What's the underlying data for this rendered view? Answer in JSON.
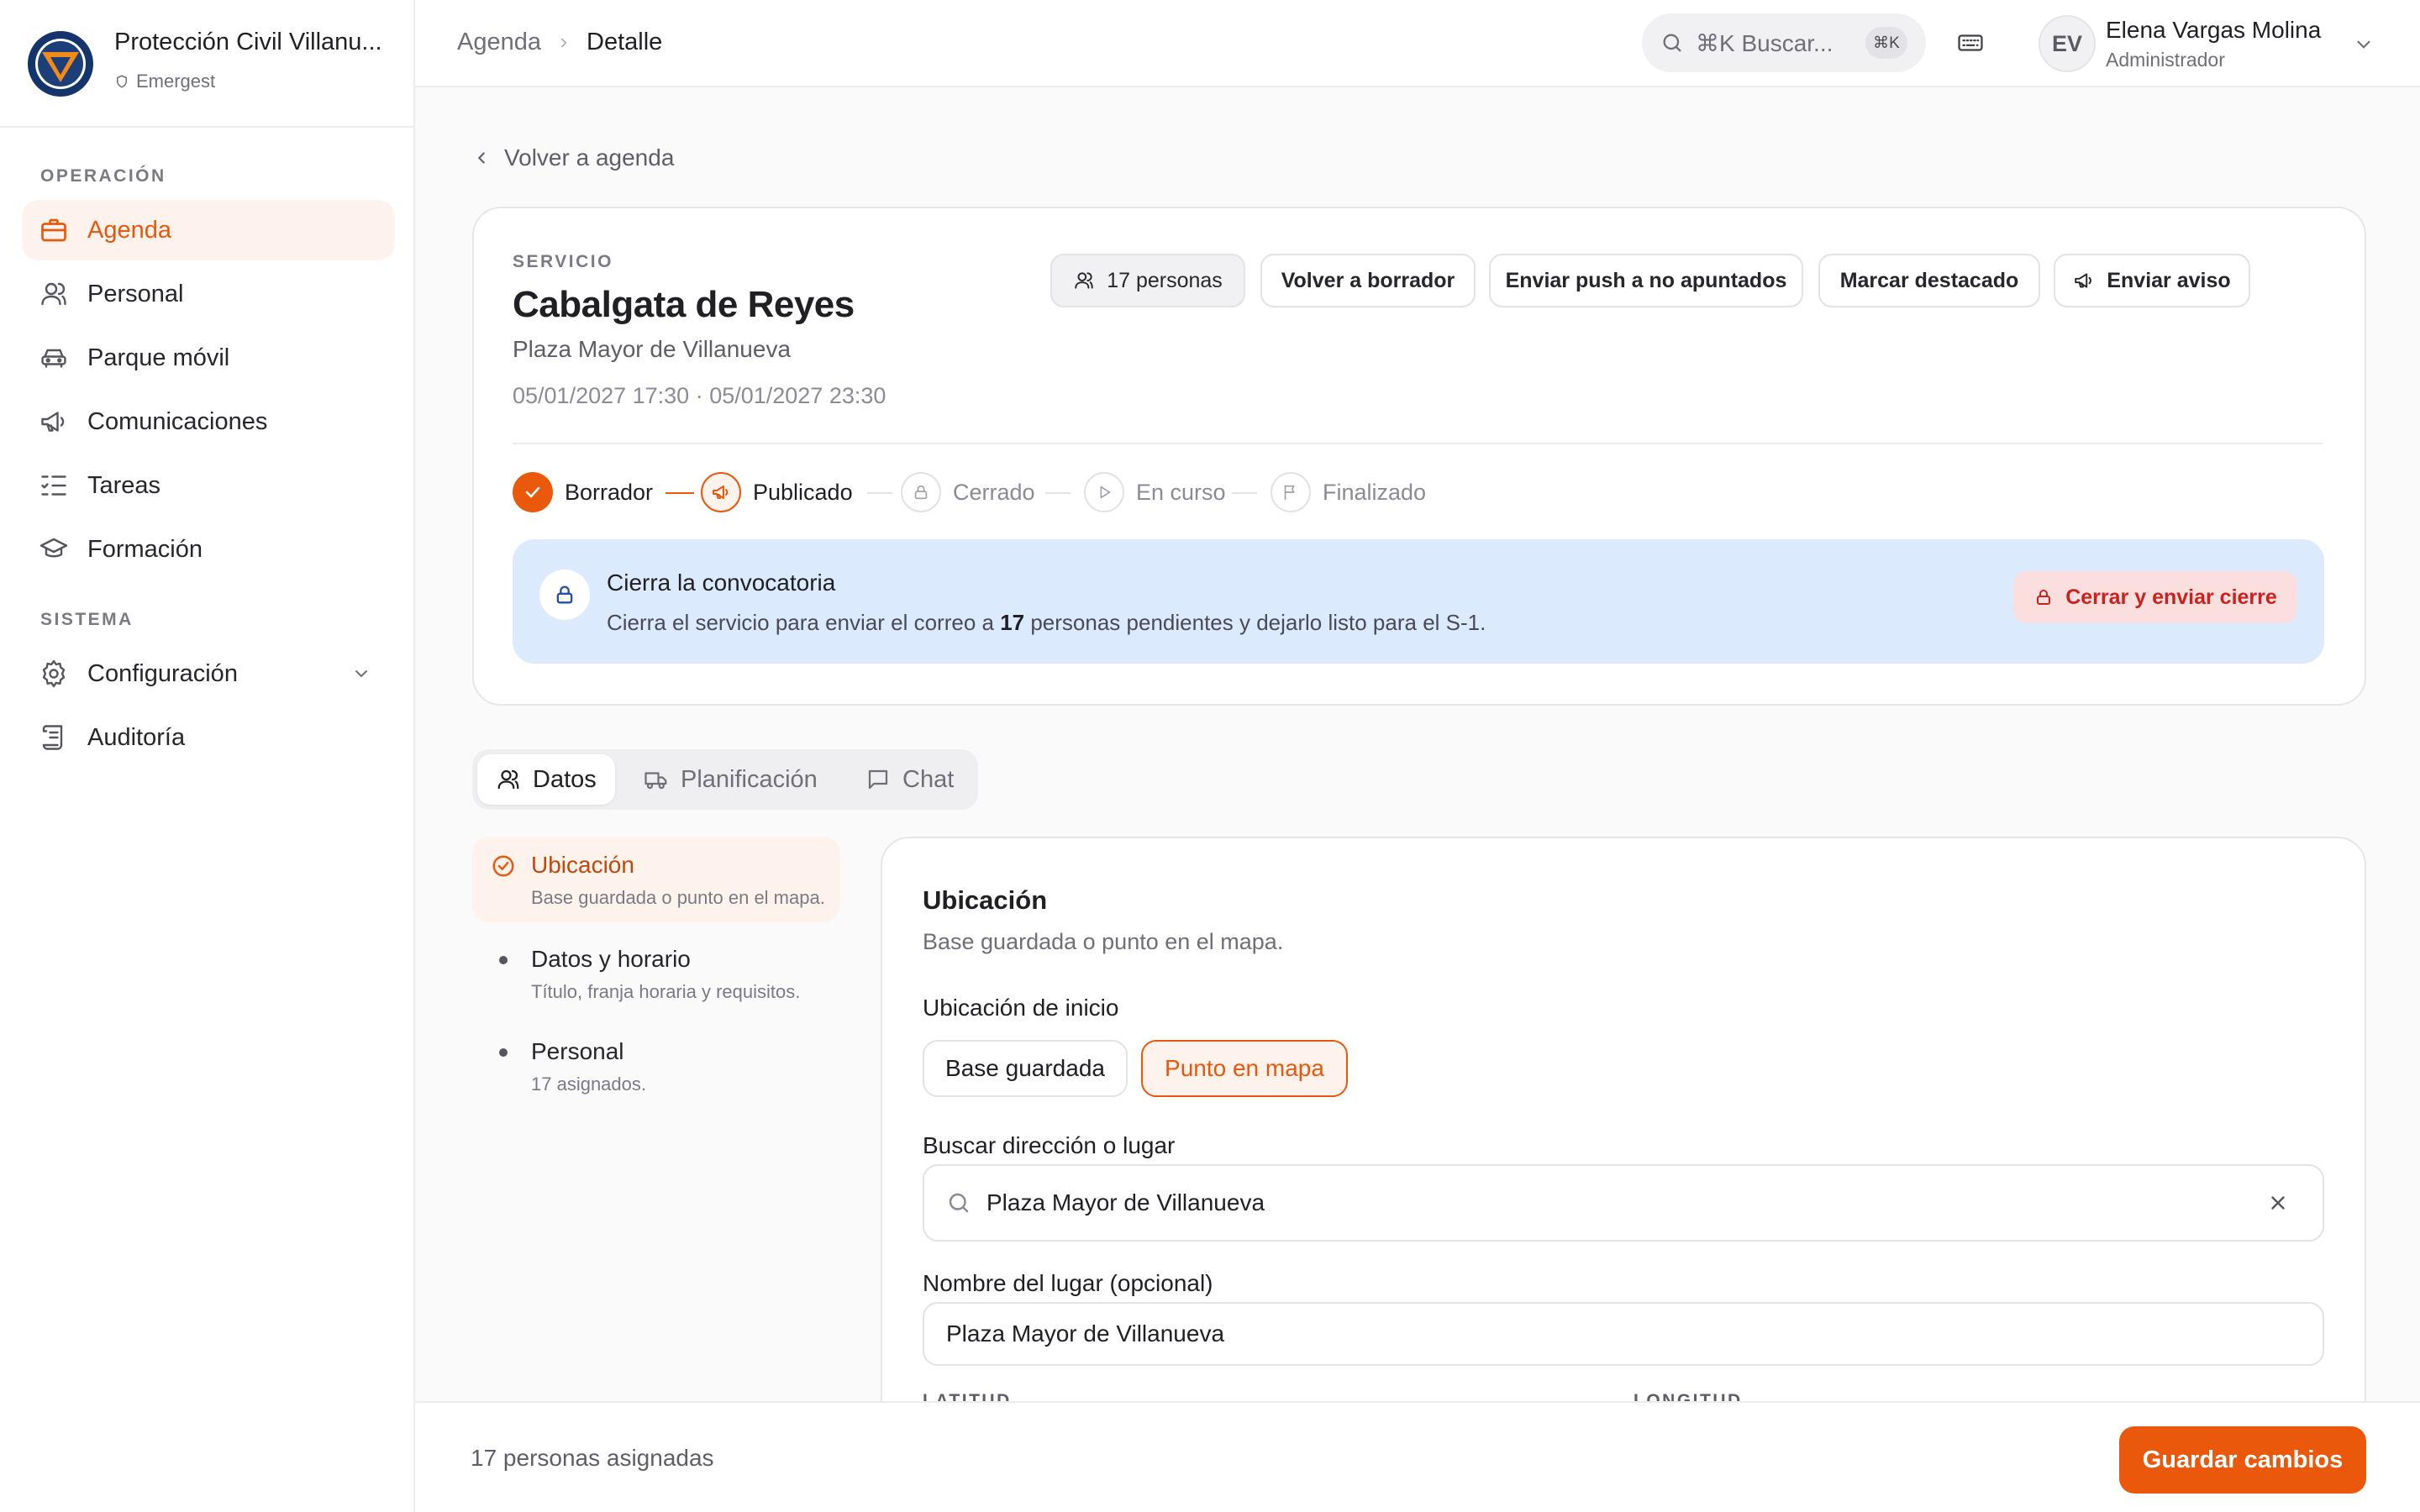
{
  "brand": {
    "title": "Protección Civil Villanu...",
    "subtitle": "Emergest",
    "logo_text": "PROTECCIÓN CIVIL"
  },
  "sidebar": {
    "sections": [
      {
        "label": "OPERACIÓN"
      },
      {
        "label": "SISTEMA"
      }
    ],
    "items": [
      {
        "label": "Agenda",
        "icon": "briefcase-icon"
      },
      {
        "label": "Personal",
        "icon": "users-icon"
      },
      {
        "label": "Parque móvil",
        "icon": "car-icon"
      },
      {
        "label": "Comunicaciones",
        "icon": "megaphone-icon"
      },
      {
        "label": "Tareas",
        "icon": "list-checks-icon"
      },
      {
        "label": "Formación",
        "icon": "graduation-cap-icon"
      },
      {
        "label": "Configuración",
        "icon": "gear-icon"
      },
      {
        "label": "Auditoría",
        "icon": "scroll-icon"
      }
    ]
  },
  "header": {
    "breadcrumb": [
      "Agenda",
      "Detalle"
    ],
    "search_placeholder": "⌘K Buscar...",
    "search_shortcut": "⌘K",
    "user": {
      "initials": "EV",
      "name": "Elena Vargas Molina",
      "role": "Administrador"
    }
  },
  "main": {
    "back_label": "Volver a agenda",
    "service": {
      "kicker": "SERVICIO",
      "title": "Cabalgata de Reyes",
      "place": "Plaza Mayor de Villanueva",
      "dates": "05/01/2027 17:30 · 05/01/2027 23:30"
    },
    "actions": {
      "people": "17 personas",
      "back_to_draft": "Volver a borrador",
      "push": "Enviar push a no apuntados",
      "highlight": "Marcar destacado",
      "notice": "Enviar aviso"
    },
    "steps": [
      {
        "label": "Borrador",
        "state": "done"
      },
      {
        "label": "Publicado",
        "state": "current"
      },
      {
        "label": "Cerrado",
        "state": "pending"
      },
      {
        "label": "En curso",
        "state": "pending"
      },
      {
        "label": "Finalizado",
        "state": "pending"
      }
    ],
    "alert": {
      "title": "Cierra la convocatoria",
      "text_before": "Cierra el servicio para enviar el correo a ",
      "count": "17",
      "text_after": " personas pendientes y dejarlo listo para el S-1.",
      "button": "Cerrar y enviar cierre"
    },
    "tabs": [
      {
        "label": "Datos"
      },
      {
        "label": "Planificación"
      },
      {
        "label": "Chat"
      }
    ],
    "subnav": [
      {
        "title": "Ubicación",
        "desc": "Base guardada o punto en el mapa."
      },
      {
        "title": "Datos y horario",
        "desc": "Título, franja horaria y requisitos."
      },
      {
        "title": "Personal",
        "desc": "17 asignados."
      }
    ],
    "form": {
      "title": "Ubicación",
      "subtitle": "Base guardada o punto en el mapa.",
      "start_label": "Ubicación de inicio",
      "options": [
        "Base guardada",
        "Punto en mapa"
      ],
      "selected_option": "Punto en mapa",
      "search_label": "Buscar dirección o lugar",
      "search_value": "Plaza Mayor de Villanueva",
      "name_label": "Nombre del lugar (opcional)",
      "name_value": "Plaza Mayor de Villanueva",
      "lat_label": "LATITUD",
      "lon_label": "LONGITUD"
    }
  },
  "footer": {
    "assigned": "17 personas asignadas",
    "save": "Guardar cambios"
  },
  "colors": {
    "accent": "#ea580c",
    "accent_soft": "#fef3ec",
    "info_bg": "#dceafd",
    "danger": "#c8231e",
    "danger_soft": "#fbdede"
  }
}
